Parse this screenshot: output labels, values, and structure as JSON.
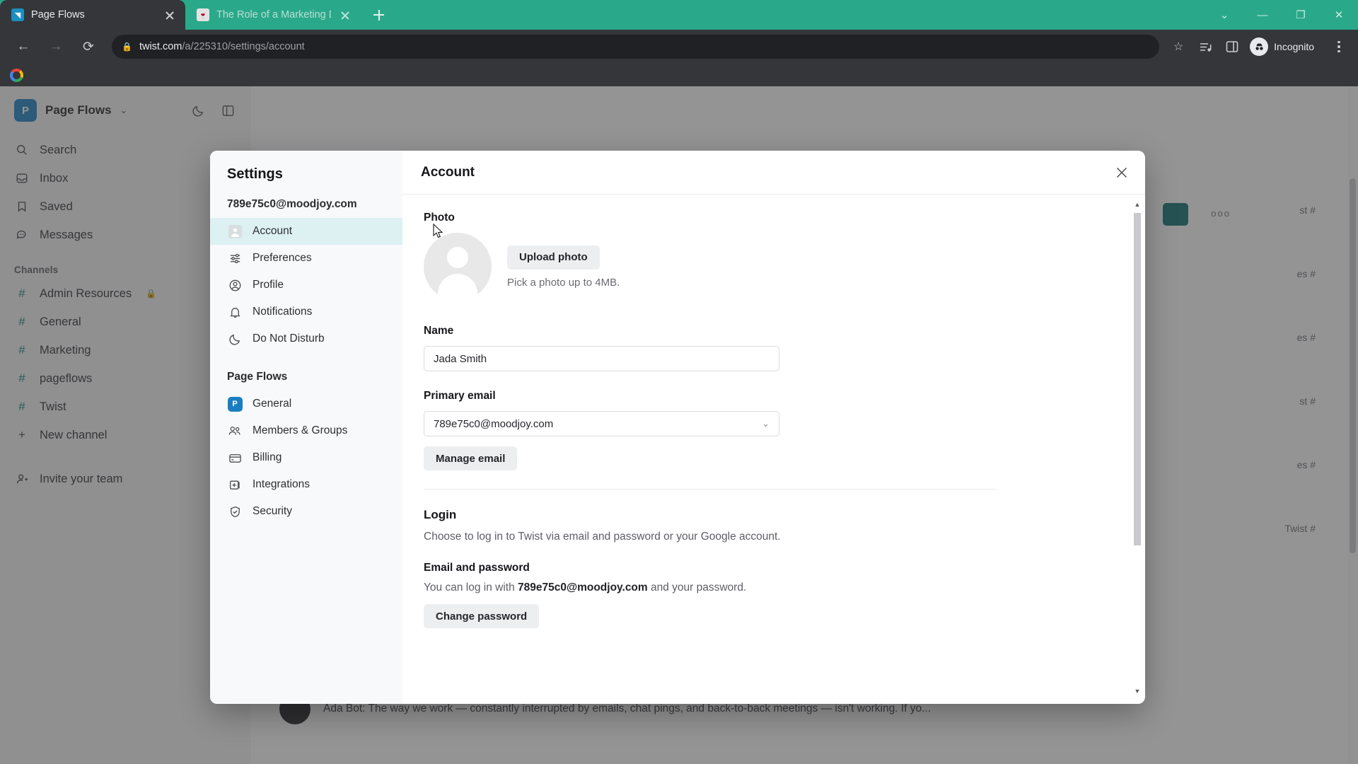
{
  "browser": {
    "tabs": [
      {
        "title": "Page Flows",
        "favicon": "pageflows-favicon",
        "active": true
      },
      {
        "title": "The Role of a Marketing Depart",
        "favicon": "article-favicon",
        "active": false
      }
    ],
    "new_tab_label": "+",
    "window_controls": [
      "chevron-down",
      "minimize",
      "restore",
      "close"
    ],
    "nav": {
      "back": "←",
      "forward": "→",
      "reload": "⟳"
    },
    "address": {
      "lock": "🔒",
      "domain": "twist.com",
      "path": "/a/225310/settings/account"
    },
    "toolbar_right": {
      "bookmark_star": "☆",
      "reading_list": "split-view-icon",
      "side_panel": "side-panel-icon",
      "profile_label": "Incognito",
      "menu": "⋮"
    },
    "bookmarks": [
      {
        "label": "",
        "icon": "google-icon"
      }
    ]
  },
  "app": {
    "workspace": {
      "initial": "P",
      "name": "Page Flows",
      "chevron": "⌄"
    },
    "header_icons": [
      "dark-mode-icon",
      "panel-toggle-icon"
    ],
    "nav": [
      {
        "label": "Search",
        "icon": "search-icon"
      },
      {
        "label": "Inbox",
        "icon": "inbox-icon"
      },
      {
        "label": "Saved",
        "icon": "bookmark-icon"
      },
      {
        "label": "Messages",
        "icon": "messages-icon"
      }
    ],
    "channels_title": "Channels",
    "channels": [
      {
        "label": "Admin Resources",
        "icon": "hash-icon",
        "private": true
      },
      {
        "label": "General",
        "icon": "hash-icon",
        "private": false
      },
      {
        "label": "Marketing",
        "icon": "hash-icon",
        "private": false
      },
      {
        "label": "pageflows",
        "icon": "hash-icon",
        "private": false
      },
      {
        "label": "Twist",
        "icon": "hash-icon",
        "private": false
      },
      {
        "label": "New channel",
        "icon": "plus-icon",
        "private": false
      }
    ],
    "invite": {
      "label": "Invite your team",
      "icon": "add-person-icon"
    },
    "background_rows": [
      "st #",
      "es #",
      "es #",
      "st #",
      "es #",
      "Twist #"
    ],
    "bottom_message": "Ada Bot: The way we work — constantly interrupted by emails, chat pings, and back-to-back meetings — isn't working. If yo..."
  },
  "modal": {
    "title": "Settings",
    "close_icon": "close-icon",
    "account_email": "789e75c0@moodjoy.com",
    "personal_items": [
      {
        "label": "Account",
        "icon": "account-icon",
        "active": true
      },
      {
        "label": "Preferences",
        "icon": "sliders-icon",
        "active": false
      },
      {
        "label": "Profile",
        "icon": "profile-icon",
        "active": false
      },
      {
        "label": "Notifications",
        "icon": "bell-icon",
        "active": false
      },
      {
        "label": "Do Not Disturb",
        "icon": "moon-icon",
        "active": false
      }
    ],
    "workspace_group_title": "Page Flows",
    "workspace_items": [
      {
        "label": "General",
        "icon": "workspace-badge",
        "badge": "P"
      },
      {
        "label": "Members & Groups",
        "icon": "people-icon"
      },
      {
        "label": "Billing",
        "icon": "card-icon"
      },
      {
        "label": "Integrations",
        "icon": "integrations-icon"
      },
      {
        "label": "Security",
        "icon": "shield-icon"
      }
    ],
    "panel": {
      "heading": "Account",
      "photo": {
        "label": "Photo",
        "upload_button": "Upload photo",
        "hint": "Pick a photo up to 4MB.",
        "avatar_icon": "default-avatar-icon"
      },
      "name": {
        "label": "Name",
        "value": "Jada Smith"
      },
      "primary_email": {
        "label": "Primary email",
        "value": "789e75c0@moodjoy.com",
        "chevron": "⌄",
        "manage_button": "Manage email"
      },
      "login": {
        "heading": "Login",
        "description": "Choose to log in to Twist via email and password or your Google account.",
        "email_password_heading": "Email and password",
        "email_password_pre": "You can log in with ",
        "email_password_bold": "789e75c0@moodjoy.com",
        "email_password_post": " and your password.",
        "change_password_button": "Change password"
      }
    },
    "scrollbar": {
      "up_arrow": "▲",
      "down_arrow": "▼"
    }
  }
}
